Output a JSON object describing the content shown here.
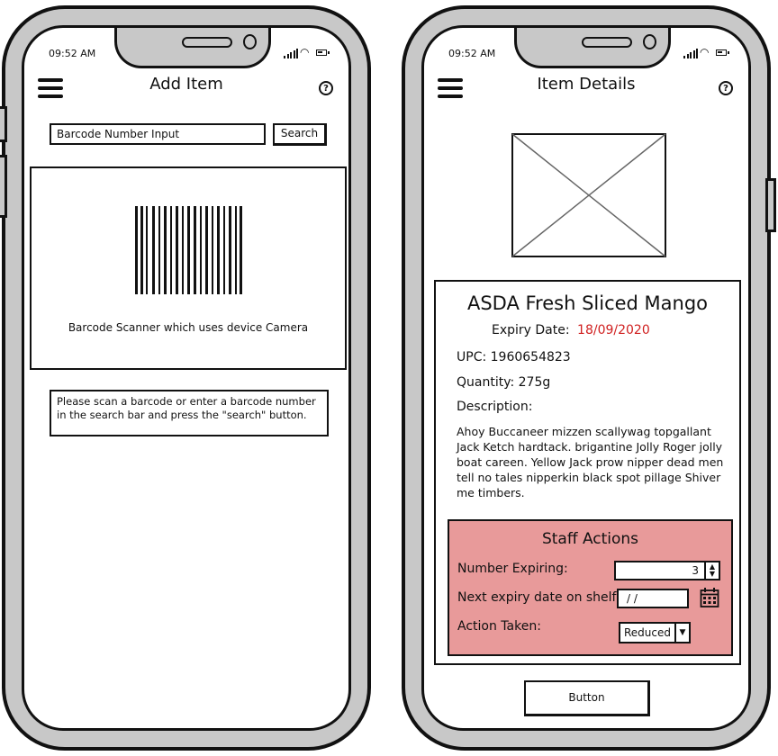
{
  "left_phone": {
    "status_time": "09:52 AM",
    "title": "Add Item",
    "help_icon": "?",
    "search_input_value": "Barcode Number Input",
    "search_button": "Search",
    "scanner_caption": "Barcode Scanner which uses device Camera",
    "instructions": "Please scan a barcode or enter a barcode number in the search bar and press the \"search\" button."
  },
  "right_phone": {
    "status_time": "09:52 AM",
    "title": "Item Details",
    "help_icon": "?",
    "product_name": "ASDA Fresh Sliced Mango",
    "expiry_label": "Expiry Date:",
    "expiry_value": "18/09/2020",
    "upc": "UPC: 1960654823",
    "quantity": "Quantity: 275g",
    "description_label": "Description:",
    "description": "Ahoy Buccaneer mizzen scallywag topgallant Jack Ketch hardtack. brigantine Jolly Roger jolly boat careen. Yellow Jack prow nipper dead men tell no tales nipperkin black spot pillage Shiver me timbers.",
    "staff": {
      "title": "Staff Actions",
      "number_expiring_label": "Number Expiring:",
      "number_expiring_value": "3",
      "next_expiry_label": "Next expiry date on shelf:",
      "next_expiry_value": "/ /",
      "action_label": "Action Taken:",
      "action_value": "Reduced"
    },
    "button": "Button"
  },
  "colors": {
    "expiry_red": "#d02020",
    "staff_panel": "#e89a9a",
    "phone_frame": "#c8c8c8"
  },
  "icons": [
    "menu-icon",
    "help-icon",
    "signal-icon",
    "wifi-icon",
    "battery-icon",
    "calendar-icon",
    "chevron-down-icon",
    "spinner-icon",
    "image-placeholder-icon",
    "barcode-icon"
  ]
}
